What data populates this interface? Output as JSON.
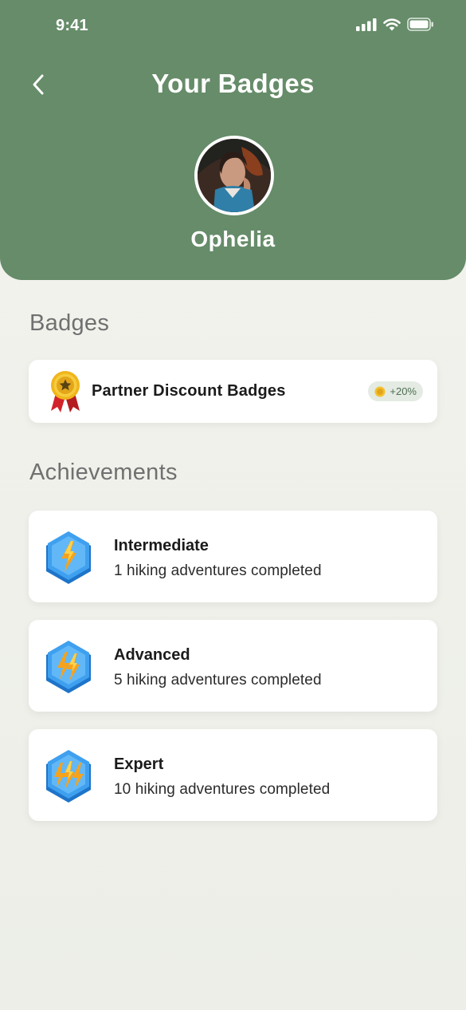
{
  "status_bar": {
    "time": "9:41",
    "icons": [
      "signal-icon",
      "wifi-icon",
      "battery-icon"
    ]
  },
  "header": {
    "back_icon": "chevron-left-icon",
    "title": "Your Badges",
    "user_name": "Ophelia"
  },
  "badges_section": {
    "title": "Badges",
    "items": [
      {
        "label": "Partner Discount Badges",
        "icon": "award-medal-icon",
        "bonus": "+20%",
        "bonus_icon": "coin-icon"
      }
    ]
  },
  "achievements_section": {
    "title": "Achievements",
    "items": [
      {
        "title": "Intermediate",
        "description": "1 hiking adventures completed",
        "icon": "lightning-hexagon-icon",
        "bolts": 1
      },
      {
        "title": "Advanced",
        "description": "5 hiking adventures completed",
        "icon": "lightning-hexagon-icon",
        "bolts": 2
      },
      {
        "title": "Expert",
        "description": "10 hiking adventures completed",
        "icon": "lightning-hexagon-icon",
        "bolts": 3
      }
    ]
  },
  "colors": {
    "header_green": "#668c69",
    "background": "#f3f3ee",
    "card": "#ffffff",
    "accent_gold": "#f2c230"
  }
}
